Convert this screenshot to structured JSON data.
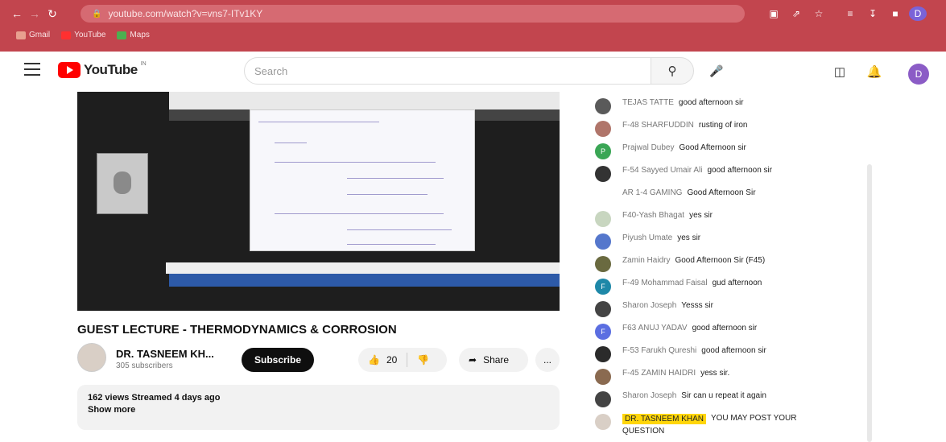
{
  "browser": {
    "url": "youtube.com/watch?v=vns7-ITv1KY",
    "bookmarks": [
      {
        "label": "Gmail",
        "color": "#e8a090"
      },
      {
        "label": "YouTube",
        "color": "#ff3030"
      },
      {
        "label": "Maps",
        "color": "#4caf50"
      }
    ]
  },
  "masthead": {
    "logo_text": "YouTube",
    "country": "IN",
    "search_placeholder": "Search",
    "avatar_letter": "D"
  },
  "video": {
    "title": "GUEST LECTURE - THERMODYNAMICS & CORROSION",
    "channel_name": "DR. TASNEEM KH...",
    "subscribers": "305 subscribers",
    "subscribe_label": "Subscribe",
    "likes": "20",
    "share_label": "Share",
    "more_label": "...",
    "views_line": "162 views  Streamed 4 days ago",
    "show_more": "Show more"
  },
  "chat": {
    "messages": [
      {
        "author": "TEJAS TATTE",
        "text": "good afternoon sir",
        "color": "#5a5a5a",
        "initial": ""
      },
      {
        "author": "F-48 SHARFUDDIN",
        "text": "rusting of iron",
        "color": "#b0756a",
        "initial": ""
      },
      {
        "author": "Prajwal Dubey",
        "text": "Good Afternoon sir",
        "color": "#3aa655",
        "initial": "P"
      },
      {
        "author": "F-54 Sayyed Umair Ali",
        "text": "good afternoon sir",
        "color": "#333333",
        "initial": ""
      },
      {
        "author": "AR 1-4 GAMING",
        "text": "Good Afternoon Sir",
        "color": "",
        "initial": ""
      },
      {
        "author": "F40-Yash Bhagat",
        "text": "yes sir",
        "color": "#c8d6c0",
        "initial": ""
      },
      {
        "author": "Piyush Umate",
        "text": "yes sir",
        "color": "#5577cc",
        "initial": ""
      },
      {
        "author": "Zamin Haidry",
        "text": "Good Afternoon Sir (F45)",
        "color": "#6a6a40",
        "initial": ""
      },
      {
        "author": "F-49 Mohammad Faisal",
        "text": "gud afternoon",
        "color": "#1e88a8",
        "initial": "F"
      },
      {
        "author": "Sharon Joseph",
        "text": "Yesss sir",
        "color": "#444444",
        "initial": ""
      },
      {
        "author": "F63 ANUJ YADAV",
        "text": "good afternoon sir",
        "color": "#5b6ee1",
        "initial": "F"
      },
      {
        "author": "F-53 Farukh Qureshi",
        "text": "good afternoon sir",
        "color": "#2b2b2b",
        "initial": ""
      },
      {
        "author": "F-45 ZAMIN HAIDRI",
        "text": "yess sir.",
        "color": "#8a6a50",
        "initial": ""
      },
      {
        "author": "Sharon Joseph",
        "text": "Sir can u repeat it again",
        "color": "#444444",
        "initial": ""
      }
    ],
    "owner_message": {
      "author": "DR. TASNEEM KHAN",
      "text": "YOU MAY POST YOUR",
      "text2": "QUESTION",
      "color": "#d9cfc6"
    }
  }
}
